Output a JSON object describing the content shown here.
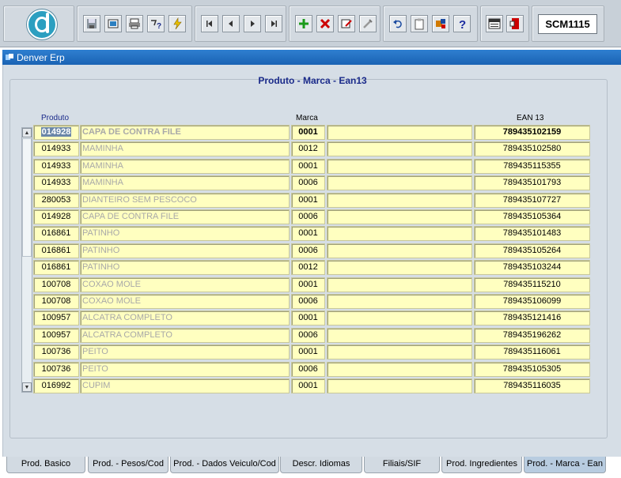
{
  "toolbar": {
    "form_code": "SCM1115",
    "buttons": [
      {
        "name": "save-icon"
      },
      {
        "name": "window-icon"
      },
      {
        "name": "print-icon"
      },
      {
        "name": "query-icon"
      },
      {
        "name": "execute-icon"
      },
      {
        "name": "first-record-icon"
      },
      {
        "name": "previous-record-icon"
      },
      {
        "name": "next-record-icon"
      },
      {
        "name": "last-record-icon"
      },
      {
        "name": "insert-record-icon"
      },
      {
        "name": "delete-record-icon"
      },
      {
        "name": "edit-record-icon"
      },
      {
        "name": "clear-icon"
      },
      {
        "name": "undo-icon"
      },
      {
        "name": "clipboard-icon"
      },
      {
        "name": "tools-icon"
      },
      {
        "name": "help-icon"
      },
      {
        "name": "menu-icon"
      },
      {
        "name": "exit-icon"
      }
    ]
  },
  "window": {
    "title": "Denver Erp"
  },
  "form": {
    "title": "Produto - Marca - Ean13",
    "headers": {
      "produto": "Produto",
      "marca": "Marca",
      "ean": "EAN 13"
    },
    "rows": [
      {
        "produto": "014928",
        "descricao": "CAPA DE CONTRA FILE",
        "marca": "0001",
        "ean": "789435102159"
      },
      {
        "produto": "014933",
        "descricao": "MAMINHA",
        "marca": "0012",
        "ean": "789435102580"
      },
      {
        "produto": "014933",
        "descricao": "MAMINHA",
        "marca": "0001",
        "ean": "789435115355"
      },
      {
        "produto": "014933",
        "descricao": "MAMINHA",
        "marca": "0006",
        "ean": "789435101793"
      },
      {
        "produto": "280053",
        "descricao": "DIANTEIRO SEM PESCOCO",
        "marca": "0001",
        "ean": "789435107727"
      },
      {
        "produto": "014928",
        "descricao": "CAPA DE CONTRA FILE",
        "marca": "0006",
        "ean": "789435105364"
      },
      {
        "produto": "016861",
        "descricao": "PATINHO",
        "marca": "0001",
        "ean": "789435101483"
      },
      {
        "produto": "016861",
        "descricao": "PATINHO",
        "marca": "0006",
        "ean": "789435105264"
      },
      {
        "produto": "016861",
        "descricao": "PATINHO",
        "marca": "0012",
        "ean": "789435103244"
      },
      {
        "produto": "100708",
        "descricao": "COXAO MOLE",
        "marca": "0001",
        "ean": "789435115210"
      },
      {
        "produto": "100708",
        "descricao": "COXAO MOLE",
        "marca": "0006",
        "ean": "789435106099"
      },
      {
        "produto": "100957",
        "descricao": "ALCATRA COMPLETO",
        "marca": "0001",
        "ean": "789435121416"
      },
      {
        "produto": "100957",
        "descricao": "ALCATRA COMPLETO",
        "marca": "0006",
        "ean": "789435196262"
      },
      {
        "produto": "100736",
        "descricao": "PEITO",
        "marca": "0001",
        "ean": "789435116061"
      },
      {
        "produto": "100736",
        "descricao": "PEITO",
        "marca": "0006",
        "ean": "789435105305"
      },
      {
        "produto": "016992",
        "descricao": "CUPIM",
        "marca": "0001",
        "ean": "789435116035"
      }
    ]
  },
  "tabs": [
    {
      "label": "Prod. Basico",
      "active": false
    },
    {
      "label": "Prod. - Pesos/Cod",
      "active": false
    },
    {
      "label": "Prod. - Dados Veiculo/Cod",
      "active": false
    },
    {
      "label": "Descr. Idiomas",
      "active": false
    },
    {
      "label": "Filiais/SIF",
      "active": false
    },
    {
      "label": "Prod. Ingredientes",
      "active": false
    },
    {
      "label": "Prod. - Marca - Ean",
      "active": true
    }
  ],
  "colors": {
    "field_bg": "#ffffc0",
    "title_blue": "#1a2a8a",
    "window_bar": "#1a63b4"
  }
}
